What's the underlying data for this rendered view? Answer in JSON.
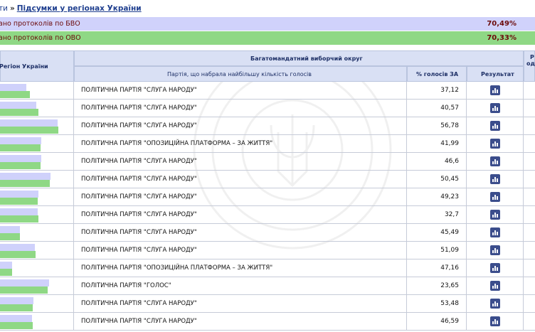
{
  "breadcrumb": {
    "prev": "ти",
    "separator": "»",
    "current": "Підсумки у регіонах України"
  },
  "summary": {
    "bvo": {
      "label": "ано протоколів по БВО",
      "value": "70,49%"
    },
    "ovo": {
      "label": "ано протоколів по ОВО",
      "value": "70,33%"
    }
  },
  "table": {
    "headers": {
      "region": "Регіон України",
      "district": "Багатомандатний виборчий округ",
      "party": "Партія, що набрала найбільшу кількість голосів",
      "percent": "% голосів ЗА",
      "result": "Результат",
      "extra_1": "Р",
      "extra_2": "оди"
    },
    "rows": [
      {
        "party": "ПОЛІТИЧНА ПАРТІЯ \"СЛУГА НАРОДУ\"",
        "percent": "37,12",
        "bvo_share": 0.36,
        "ovo_share": 0.4
      },
      {
        "party": "ПОЛІТИЧНА ПАРТІЯ \"СЛУГА НАРОДУ\"",
        "percent": "40,57",
        "bvo_share": 0.49,
        "ovo_share": 0.52
      },
      {
        "party": "ПОЛІТИЧНА ПАРТІЯ \"СЛУГА НАРОДУ\"",
        "percent": "56,78",
        "bvo_share": 0.78,
        "ovo_share": 0.79
      },
      {
        "party": "ПОЛІТИЧНА ПАРТІЯ \"ОПОЗИЦІЙНА ПЛАТФОРМА – ЗА ЖИТТЯ\"",
        "percent": "41,99",
        "bvo_share": 0.56,
        "ovo_share": 0.55
      },
      {
        "party": "ПОЛІТИЧНА ПАРТІЯ \"СЛУГА НАРОДУ\"",
        "percent": "46,6",
        "bvo_share": 0.56,
        "ovo_share": 0.55
      },
      {
        "party": "ПОЛІТИЧНА ПАРТІЯ \"СЛУГА НАРОДУ\"",
        "percent": "50,45",
        "bvo_share": 0.68,
        "ovo_share": 0.67
      },
      {
        "party": "ПОЛІТИЧНА ПАРТІЯ \"СЛУГА НАРОДУ\"",
        "percent": "49,23",
        "bvo_share": 0.52,
        "ovo_share": 0.51
      },
      {
        "party": "ПОЛІТИЧНА ПАРТІЯ \"СЛУГА НАРОДУ\"",
        "percent": "32,7",
        "bvo_share": 0.51,
        "ovo_share": 0.52
      },
      {
        "party": "ПОЛІТИЧНА ПАРТІЯ \"СЛУГА НАРОДУ\"",
        "percent": "45,49",
        "bvo_share": 0.27,
        "ovo_share": 0.27
      },
      {
        "party": "ПОЛІТИЧНА ПАРТІЯ \"СЛУГА НАРОДУ\"",
        "percent": "51,09",
        "bvo_share": 0.47,
        "ovo_share": 0.48
      },
      {
        "party": "ПОЛІТИЧНА ПАРТІЯ \"ОПОЗИЦІЙНА ПЛАТФОРМА – ЗА ЖИТТЯ\"",
        "percent": "47,16",
        "bvo_share": 0.16,
        "ovo_share": 0.16
      },
      {
        "party": "ПОЛІТИЧНА ПАРТІЯ \"ГОЛОС\"",
        "percent": "23,65",
        "bvo_share": 0.66,
        "ovo_share": 0.64
      },
      {
        "party": "ПОЛІТИЧНА ПАРТІЯ \"СЛУГА НАРОДУ\"",
        "percent": "53,48",
        "bvo_share": 0.45,
        "ovo_share": 0.44
      },
      {
        "party": "ПОЛІТИЧНА ПАРТІЯ \"СЛУГА НАРОДУ\"",
        "percent": "46,59",
        "bvo_share": 0.43,
        "ovo_share": 0.44
      }
    ]
  },
  "icons": {
    "result": "bar-chart-icon",
    "watermark": "emblem-icon"
  },
  "colors": {
    "bvo": "#cfd1fb",
    "ovo": "#8fd885",
    "header": "#d9e0f4",
    "accent_text": "#6b0a0a",
    "link": "#1f3f8f"
  }
}
